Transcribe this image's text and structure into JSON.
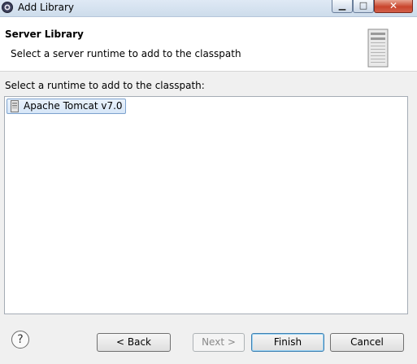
{
  "window": {
    "title": "Add Library"
  },
  "banner": {
    "title": "Server Library",
    "description": "Select a server runtime to add to the classpath"
  },
  "runtimes": {
    "label": "Select a runtime to add to the classpath:",
    "items": [
      {
        "label": "Apache Tomcat v7.0",
        "icon": "server-icon"
      }
    ]
  },
  "footer": {
    "help_glyph": "?",
    "back_label": "< Back",
    "next_label": "Next >",
    "finish_label": "Finish",
    "cancel_label": "Cancel"
  },
  "colors": {
    "titlebar": "#cddceb",
    "close_button": "#c9452d",
    "selection": "#d6e6f7"
  }
}
